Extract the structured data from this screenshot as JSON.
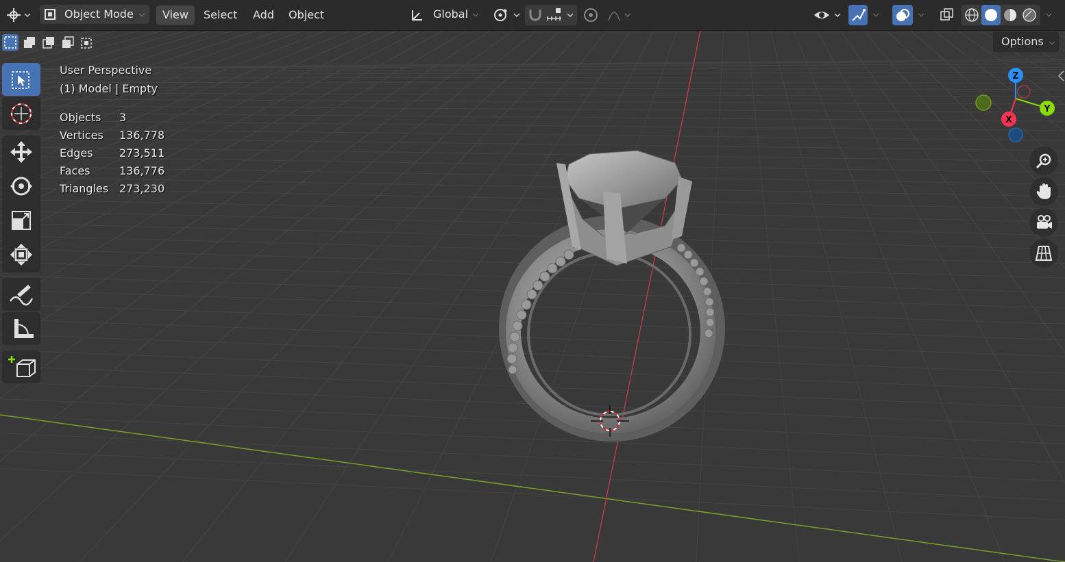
{
  "header": {
    "editor_type_icon": "3d-viewport-icon",
    "mode": "Object Mode",
    "menus": [
      "View",
      "Select",
      "Add",
      "Object"
    ],
    "active_menu": "View",
    "transform_orientation": "Global",
    "options_label": "Options"
  },
  "overlay": {
    "view_name": "User Perspective",
    "context": "(1) Model | Empty",
    "stats": [
      {
        "label": "Objects",
        "value": "3"
      },
      {
        "label": "Vertices",
        "value": "136,778"
      },
      {
        "label": "Edges",
        "value": "273,511"
      },
      {
        "label": "Faces",
        "value": "136,776"
      },
      {
        "label": "Triangles",
        "value": "273,230"
      }
    ]
  },
  "gizmo": {
    "x": "X",
    "y": "Y",
    "z": "Z"
  },
  "toolbar": {
    "tools": [
      "select-box-icon",
      "cursor-icon",
      "move-icon",
      "rotate-icon",
      "scale-icon",
      "transform-icon",
      "annotate-icon",
      "measure-icon",
      "add-cube-icon"
    ],
    "active_tool": "select-box-icon"
  },
  "navigation": [
    "zoom-icon",
    "hand-pan-icon",
    "camera-icon",
    "ortho-grid-icon"
  ],
  "colors": {
    "background": "#393939",
    "header": "#2b2b2b",
    "active_blue": "#4772b3",
    "axis_x": "#ff3352",
    "axis_y": "#8bdc00",
    "axis_z": "#2890ff"
  }
}
